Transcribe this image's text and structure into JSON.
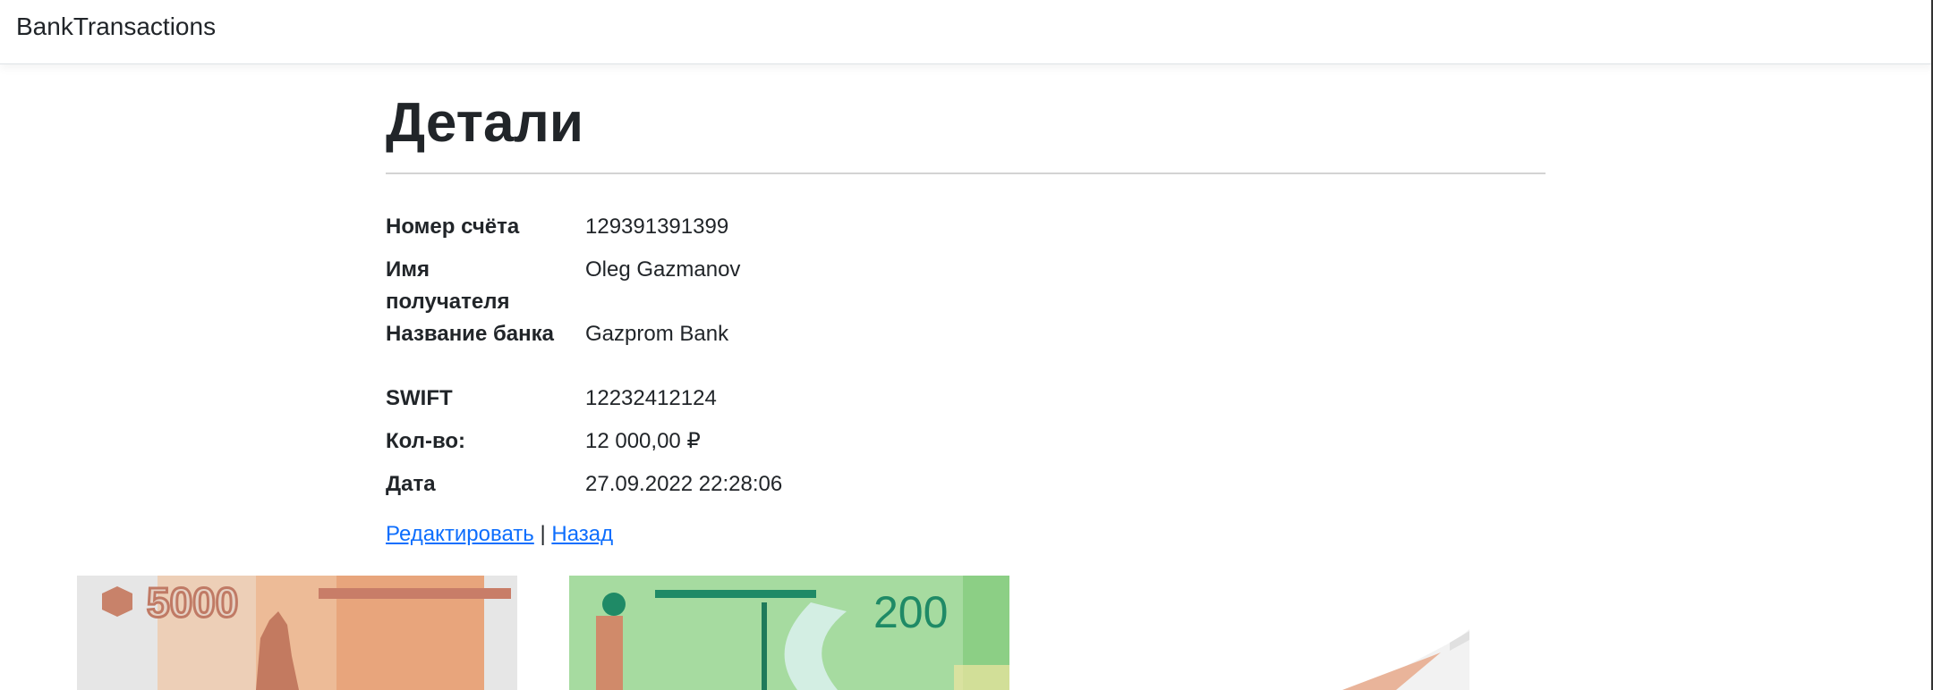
{
  "navbar": {
    "brand": "BankTransactions"
  },
  "page": {
    "title": "Детали"
  },
  "details": [
    {
      "label": "Номер счёта",
      "value": "129391391399"
    },
    {
      "label": "Имя получателя",
      "value": "Oleg Gazmanov"
    },
    {
      "label": "Название банка",
      "value": "Gazprom Bank"
    },
    {
      "label": "SWIFT",
      "value": "12232412124"
    },
    {
      "label": "Кол-во:",
      "value": "12 000,00 ₽"
    },
    {
      "label": "Дата",
      "value": "27.09.2022 22:28:06"
    }
  ],
  "actions": {
    "edit_label": "Редактировать",
    "separator": "|",
    "back_label": "Назад"
  },
  "banknotes": [
    {
      "denomination": "5000"
    },
    {
      "denomination": "200"
    }
  ],
  "colors": {
    "link": "#0d6efd",
    "text": "#212529",
    "note5000": "#d98a5c",
    "note200": "#2e8b6e"
  }
}
